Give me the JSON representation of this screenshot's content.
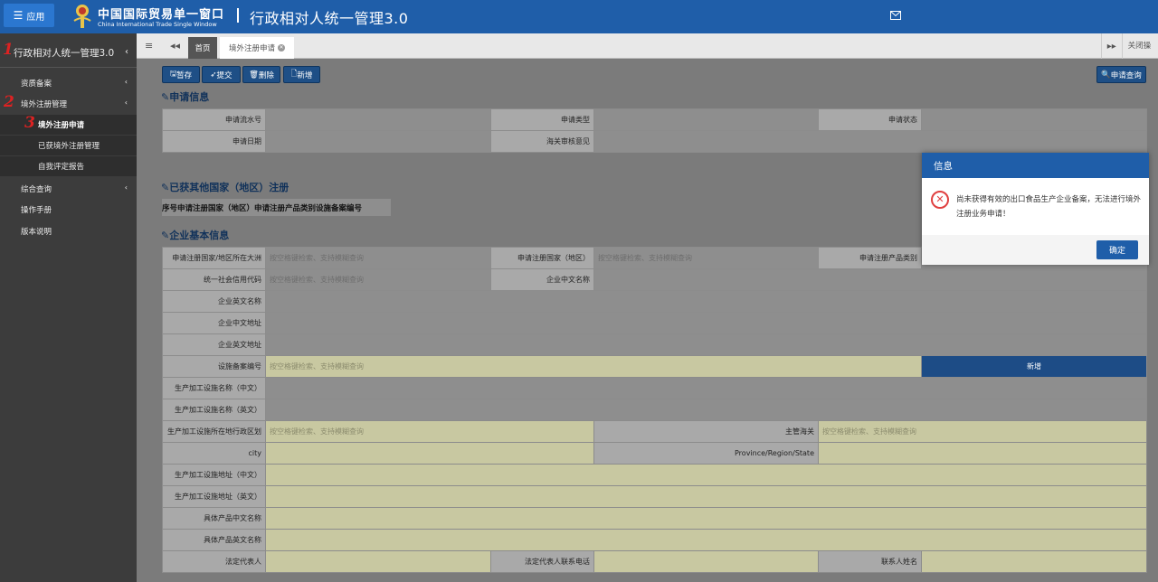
{
  "header": {
    "app_button": "应用",
    "brand_cn": "中国国际贸易单一窗口",
    "brand_en": "China International Trade Single Window",
    "system_title": "行政相对人统一管理3.0"
  },
  "sidebar": {
    "title": "行政相对人统一管理3.0",
    "items": [
      {
        "label": "资质备案"
      },
      {
        "label": "境外注册管理"
      },
      {
        "label": "综合查询"
      },
      {
        "label": "操作手册"
      },
      {
        "label": "版本说明"
      }
    ],
    "subitems": [
      {
        "label": "境外注册申请"
      },
      {
        "label": "已获境外注册管理"
      },
      {
        "label": "自我评定报告"
      }
    ],
    "step_marks": [
      "1",
      "2",
      "3"
    ]
  },
  "tabs": {
    "home": "首页",
    "current": "境外注册申请",
    "close_ops": "关闭操"
  },
  "toolbar": {
    "save": "暂存",
    "submit": "提交",
    "delete": "删除",
    "add": "新增",
    "query": "申请查询"
  },
  "apply_info": {
    "title": "申请信息",
    "serial_label": "申请流水号",
    "type_label": "申请类型",
    "status_label": "申请状态",
    "date_label": "申请日期",
    "customs_opinion_label": "海关审核意见"
  },
  "other_reg": {
    "title": "已获其他国家（地区）注册",
    "columns": "序号申请注册国家（地区）申请注册产品类别设施备案编号"
  },
  "company": {
    "title": "企业基本信息",
    "placeholder": "按空格键检索、支持模糊查询",
    "continent_label": "申请注册国家/地区所在大洲",
    "country_label": "申请注册国家（地区）",
    "product_cat_label": "申请注册产品类别",
    "credit_code_label": "统一社会信用代码",
    "name_cn_label": "企业中文名称",
    "name_en_label": "企业英文名称",
    "addr_cn_label": "企业中文地址",
    "addr_en_label": "企业英文地址",
    "facility_no_label": "设施备案编号",
    "new_button": "新增",
    "fac_name_cn_label": "生产加工设施名称（中文）",
    "fac_name_en_label": "生产加工设施名称（英文）",
    "fac_region_label": "生产加工设施所在地行政区划",
    "competent_customs_label": "主管海关",
    "city_label": "city",
    "province_label": "Province/Region/State",
    "fac_addr_cn_label": "生产加工设施地址（中文）",
    "fac_addr_en_label": "生产加工设施地址（英文）",
    "product_cn_label": "具体产品中文名称",
    "product_en_label": "具体产品英文名称",
    "legal_rep_label": "法定代表人",
    "legal_rep_phone_label": "法定代表人联系电话",
    "contact_name_label": "联系人姓名"
  },
  "dialog": {
    "title": "信息",
    "message": "尚未获得有效的出口食品生产企业备案，无法进行境外注册业务申请！",
    "ok": "确定"
  }
}
